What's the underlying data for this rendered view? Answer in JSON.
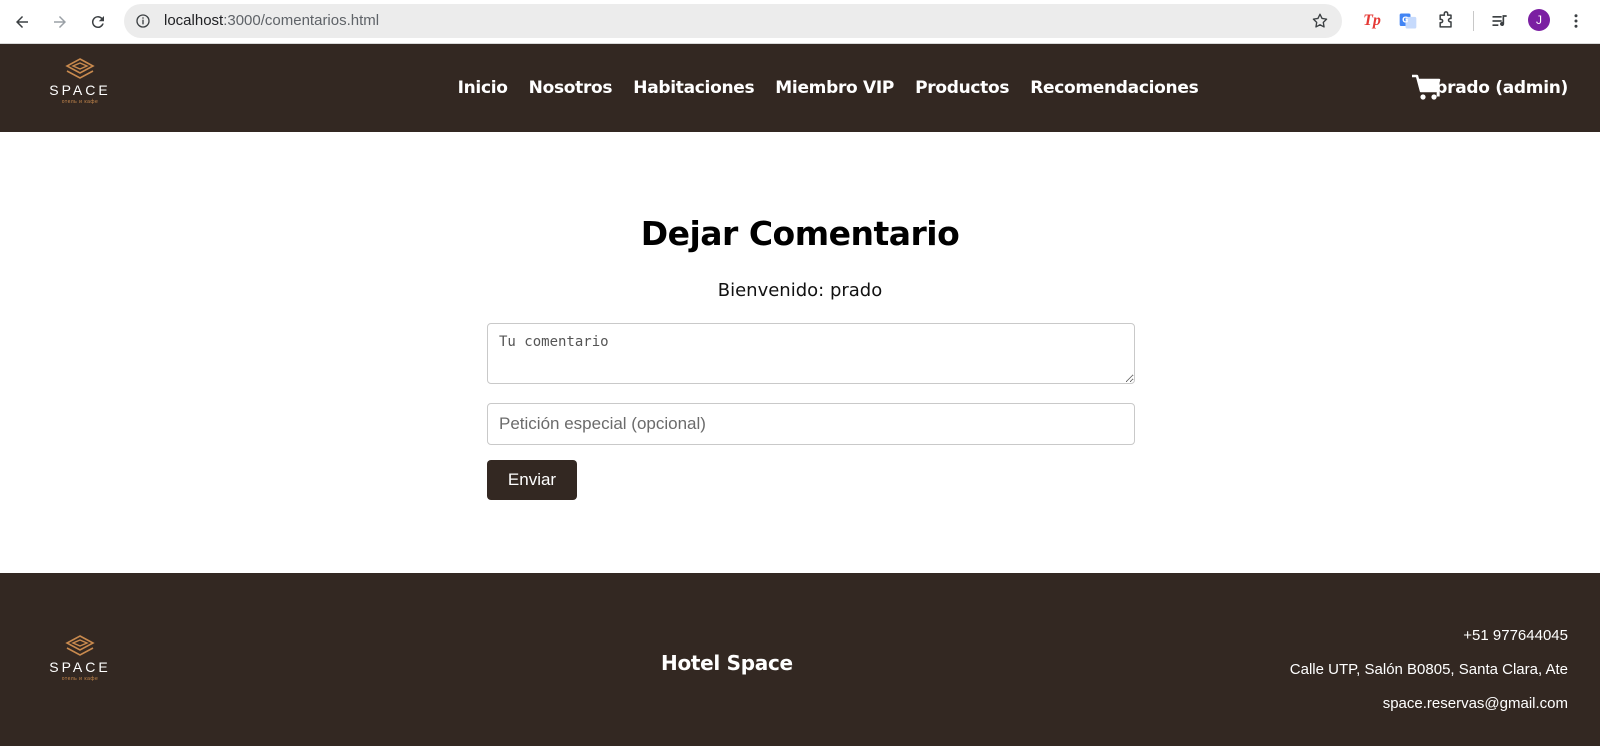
{
  "browser": {
    "url_host": "localhost",
    "url_path": ":3000/comentarios.html",
    "avatar_letter": "J",
    "ext_tp_label": "Tp"
  },
  "header": {
    "logo_text": "SPACE",
    "logo_sub": "отель и кафе",
    "nav": [
      "Inicio",
      "Nosotros",
      "Habitaciones",
      "Miembro VIP",
      "Productos",
      "Recomendaciones"
    ],
    "user_label": "prado (admin)",
    "cart_icon": "shopping-cart-icon"
  },
  "main": {
    "title": "Dejar Comentario",
    "welcome": "Bienvenido: prado",
    "comment_placeholder": "Tu comentario",
    "request_placeholder": "Petición especial (opcional)",
    "submit_label": "Enviar"
  },
  "footer": {
    "logo_text": "SPACE",
    "logo_sub": "отель и кафе",
    "brand": "Hotel Space",
    "phone": "+51 977644045",
    "address": "Calle UTP, Salón B0805, Santa Clara, Ate",
    "email": "space.reservas@gmail.com"
  },
  "colors": {
    "brand_dark": "#332822",
    "logo_accent": "#c98a4e"
  }
}
